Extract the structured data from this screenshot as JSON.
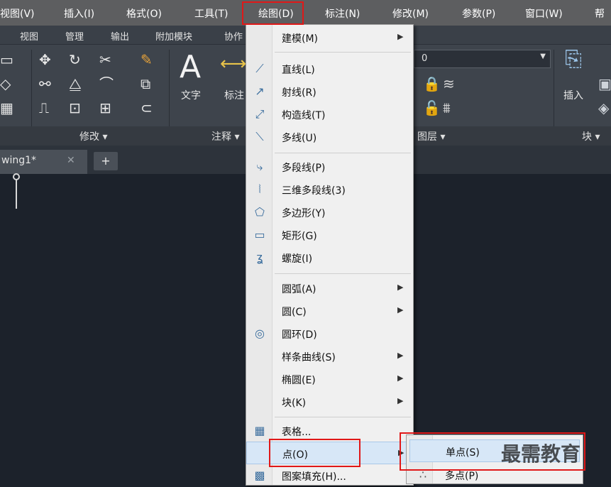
{
  "menubar": {
    "items": [
      "视图(V)",
      "插入(I)",
      "格式(O)",
      "工具(T)",
      "绘图(D)",
      "标注(N)",
      "修改(M)",
      "参数(P)",
      "窗口(W)",
      "帮"
    ]
  },
  "subtabs": {
    "items": [
      "视图",
      "管理",
      "输出",
      "附加模块",
      "协作"
    ]
  },
  "ribbon": {
    "text_label": "文字",
    "annotate_label": "标注",
    "insert_label": "插入",
    "layer_value": "0"
  },
  "panels": {
    "modify": "修改 ▾",
    "annotation": "注释 ▾",
    "layers": "图层 ▾",
    "block": "块 ▾"
  },
  "doc_tab": {
    "name": "wing1*",
    "close": "✕",
    "plus": "+"
  },
  "draw_menu": {
    "items": [
      {
        "label": "建模(M)",
        "icon": "",
        "arrow": "▶"
      },
      {
        "label": "直线(L)",
        "icon": "line-icon",
        "arrow": ""
      },
      {
        "label": "射线(R)",
        "icon": "ray-icon",
        "arrow": ""
      },
      {
        "label": "构造线(T)",
        "icon": "xline-icon",
        "arrow": ""
      },
      {
        "label": "多线(U)",
        "icon": "mline-icon",
        "arrow": ""
      },
      {
        "label": "多段线(P)",
        "icon": "polyline-icon",
        "arrow": ""
      },
      {
        "label": "三维多段线(3)",
        "icon": "3dpoly-icon",
        "arrow": ""
      },
      {
        "label": "多边形(Y)",
        "icon": "polygon-icon",
        "arrow": ""
      },
      {
        "label": "矩形(G)",
        "icon": "rectangle-icon",
        "arrow": ""
      },
      {
        "label": "螺旋(I)",
        "icon": "helix-icon",
        "arrow": ""
      },
      {
        "label": "圆弧(A)",
        "icon": "",
        "arrow": "▶"
      },
      {
        "label": "圆(C)",
        "icon": "",
        "arrow": "▶"
      },
      {
        "label": "圆环(D)",
        "icon": "donut-icon",
        "arrow": ""
      },
      {
        "label": "样条曲线(S)",
        "icon": "",
        "arrow": "▶"
      },
      {
        "label": "椭圆(E)",
        "icon": "",
        "arrow": "▶"
      },
      {
        "label": "块(K)",
        "icon": "",
        "arrow": "▶"
      },
      {
        "label": "表格...",
        "icon": "table-icon",
        "arrow": ""
      },
      {
        "label": "点(O)",
        "icon": "",
        "arrow": "▶"
      },
      {
        "label": "图案填充(H)...",
        "icon": "hatch-icon",
        "arrow": ""
      }
    ]
  },
  "point_submenu": {
    "items": [
      "单点(S)",
      "多点(P)"
    ]
  },
  "watermark": "最需教育"
}
